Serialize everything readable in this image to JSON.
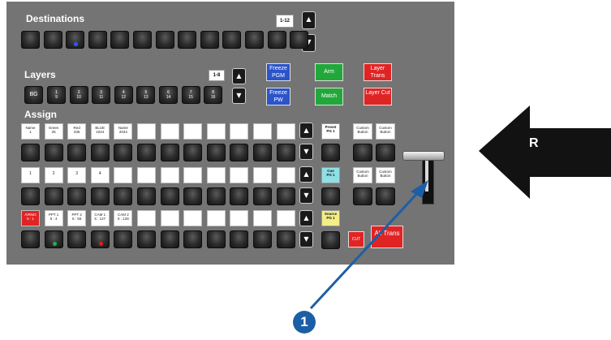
{
  "destinations": {
    "title": "Destinations",
    "range": "1-12",
    "up_icon": "arrow-up-icon",
    "down_icon": "arrow-down-icon"
  },
  "layers": {
    "title": "Layers",
    "range": "1-8",
    "bg_label": "BG",
    "keys": [
      {
        "top": "1",
        "bottom": "9"
      },
      {
        "top": "2",
        "bottom": "10"
      },
      {
        "top": "3",
        "bottom": "11"
      },
      {
        "top": "4",
        "bottom": "12"
      },
      {
        "top": "5",
        "bottom": "13"
      },
      {
        "top": "6",
        "bottom": "14"
      },
      {
        "top": "7",
        "bottom": "15"
      },
      {
        "top": "8",
        "bottom": "16"
      }
    ]
  },
  "controls": {
    "freeze_pgm": "Freeze PGM",
    "freeze_pw": "Freeze PW",
    "arm": "Arm",
    "match": "Match",
    "layer_trans": "Layer Trans",
    "layer_cut": "Layer Cut",
    "cut": "CUT",
    "all_trans": "All Trans"
  },
  "assign": {
    "title": "Assign",
    "row1_labels": [
      {
        "line1": "Name",
        "line2": "1"
      },
      {
        "line1": "Green",
        "line2": "25"
      },
      {
        "line1": "Red",
        "line2": "335"
      },
      {
        "line1": "BLUE",
        "line2": "1024"
      },
      {
        "line1": "Name",
        "line2": "2044"
      }
    ],
    "row2_labels": [
      "1",
      "2",
      "3",
      "4"
    ],
    "row3_labels": [
      {
        "line1": "AIRNO",
        "line2": "5 : 1"
      },
      {
        "line1": "PPT 1",
        "line2": "5 : 4"
      },
      {
        "line1": "PPT 2",
        "line2": "5 : 55"
      },
      {
        "line1": "CAM 1",
        "line2": "5 : 127"
      },
      {
        "line1": "CAM 2",
        "line2": "5 : 128"
      }
    ],
    "preset": {
      "line1": "Preset",
      "line2": "PG 1"
    },
    "cue": {
      "line1": "Cue",
      "line2": "PG 1"
    },
    "source": {
      "line1": "Source",
      "line2": "PG 1"
    }
  },
  "custom_buttons": [
    {
      "line1": "Custom",
      "line2": "Button"
    },
    {
      "line1": "Custom",
      "line2": "Button"
    },
    {
      "line1": "Custom",
      "line2": "Button"
    },
    {
      "line1": "Custom",
      "line2": "Button"
    }
  ],
  "callout": {
    "number": "1"
  },
  "side_arrow": {
    "letter": "R"
  },
  "colors": {
    "panel": "#747474",
    "freeze": "#2b54c9",
    "arm": "#22a83a",
    "layer": "#e02424",
    "callout": "#1c5fa6",
    "led_blue": "#2f56ff",
    "led_green": "#1fb24a",
    "led_red": "#e11b1b",
    "cue_bg": "#8fe0e6",
    "source_bg": "#f4ee87"
  }
}
